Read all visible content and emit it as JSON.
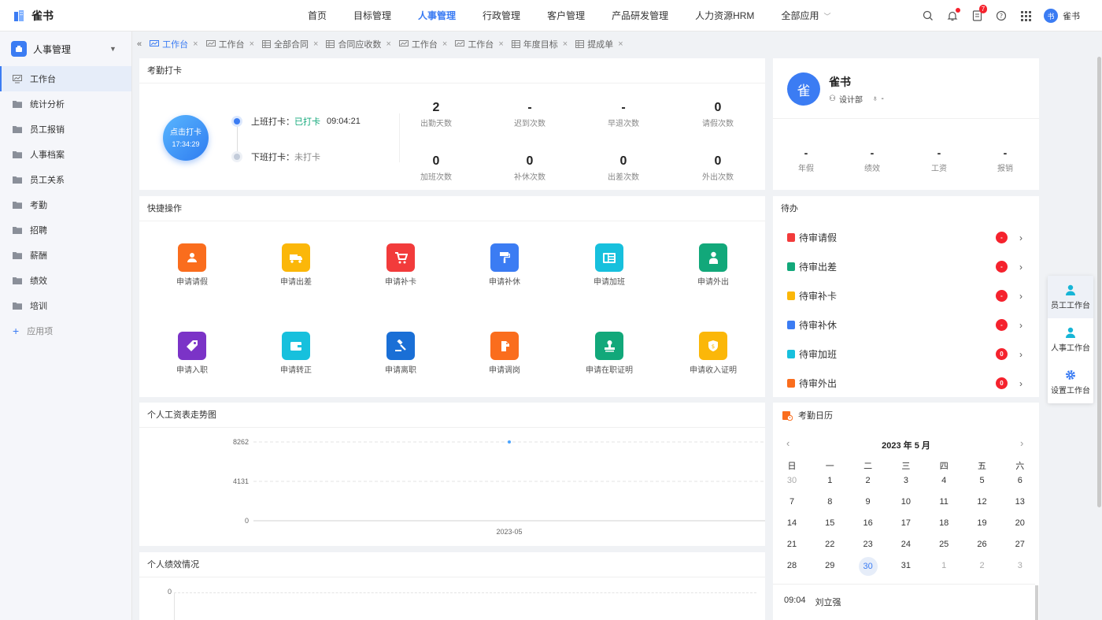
{
  "app": {
    "name": "雀书"
  },
  "topnav": [
    {
      "label": "首页",
      "active": false
    },
    {
      "label": "目标管理",
      "active": false
    },
    {
      "label": "人事管理",
      "active": true
    },
    {
      "label": "行政管理",
      "active": false
    },
    {
      "label": "客户管理",
      "active": false
    },
    {
      "label": "产品研发管理",
      "active": false
    },
    {
      "label": "人力资源HRM",
      "active": false
    },
    {
      "label": "全部应用",
      "active": false
    }
  ],
  "header": {
    "notification_count": "7",
    "user_avatar": "书",
    "user_name": "雀书"
  },
  "sidebar": {
    "module": "人事管理",
    "items": [
      {
        "label": "工作台",
        "icon": "monitor-icon",
        "active": true
      },
      {
        "label": "统计分析",
        "icon": "folder-icon"
      },
      {
        "label": "员工报销",
        "icon": "folder-icon"
      },
      {
        "label": "人事档案",
        "icon": "folder-icon"
      },
      {
        "label": "员工关系",
        "icon": "folder-icon"
      },
      {
        "label": "考勤",
        "icon": "folder-icon"
      },
      {
        "label": "招聘",
        "icon": "folder-icon"
      },
      {
        "label": "薪酬",
        "icon": "folder-icon"
      },
      {
        "label": "绩效",
        "icon": "folder-icon"
      },
      {
        "label": "培训",
        "icon": "folder-icon"
      }
    ],
    "add_label": "应用项"
  },
  "tabs": [
    {
      "label": "工作台",
      "icon": "chart-icon",
      "active": true
    },
    {
      "label": "工作台",
      "icon": "chart-icon"
    },
    {
      "label": "全部合同",
      "icon": "table-icon"
    },
    {
      "label": "合同应收数",
      "icon": "table-icon"
    },
    {
      "label": "工作台",
      "icon": "chart-icon"
    },
    {
      "label": "工作台",
      "icon": "chart-icon"
    },
    {
      "label": "年度目标",
      "icon": "table-icon"
    },
    {
      "label": "提成单",
      "icon": "table-icon"
    }
  ],
  "attendance": {
    "title": "考勤打卡",
    "punch_button": "点击打卡",
    "punch_time": "17:34:29",
    "clock_in_label": "上班打卡：",
    "clock_in_status": "已打卡",
    "clock_in_time": "09:04:21",
    "clock_out_label": "下班打卡：",
    "clock_out_status": "未打卡",
    "stats": [
      {
        "value": "2",
        "label": "出勤天数"
      },
      {
        "value": "-",
        "label": "迟到次数"
      },
      {
        "value": "-",
        "label": "早退次数"
      },
      {
        "value": "0",
        "label": "请假次数"
      },
      {
        "value": "0",
        "label": "加班次数"
      },
      {
        "value": "0",
        "label": "补休次数"
      },
      {
        "value": "0",
        "label": "出差次数"
      },
      {
        "value": "0",
        "label": "外出次数"
      }
    ]
  },
  "profile": {
    "avatar": "雀",
    "name": "雀书",
    "dept": "设计部",
    "extra": "-",
    "stats": [
      {
        "value": "-",
        "label": "年假"
      },
      {
        "value": "-",
        "label": "绩效"
      },
      {
        "value": "-",
        "label": "工资"
      },
      {
        "value": "-",
        "label": "报销"
      }
    ]
  },
  "quick": {
    "title": "快捷操作",
    "items": [
      {
        "label": "申请请假",
        "color": "#fa6d1d",
        "icon": "people-icon"
      },
      {
        "label": "申请出差",
        "color": "#fbb709",
        "icon": "truck-icon"
      },
      {
        "label": "申请补卡",
        "color": "#f23b3b",
        "icon": "cart-icon"
      },
      {
        "label": "申请补休",
        "color": "#3b7cf3",
        "icon": "paint-roller-icon"
      },
      {
        "label": "申请加班",
        "color": "#17c0dd",
        "icon": "list-icon"
      },
      {
        "label": "申请外出",
        "color": "#12a87a",
        "icon": "person-icon"
      },
      {
        "label": "申请入职",
        "color": "#7b33c7",
        "icon": "tag-icon"
      },
      {
        "label": "申请转正",
        "color": "#17c0dd",
        "icon": "wallet-icon"
      },
      {
        "label": "申请离职",
        "color": "#1a6fd6",
        "icon": "gavel-icon"
      },
      {
        "label": "申请调岗",
        "color": "#fa6d1d",
        "icon": "dog-icon"
      },
      {
        "label": "申请在职证明",
        "color": "#12a87a",
        "icon": "stamp-icon"
      },
      {
        "label": "申请收入证明",
        "color": "#fbb709",
        "icon": "money-shield-icon"
      }
    ]
  },
  "todo": {
    "title": "待办",
    "items": [
      {
        "label": "待审请假",
        "badge": "-",
        "color": "#f23b3b"
      },
      {
        "label": "待审出差",
        "badge": "-",
        "color": "#12a87a"
      },
      {
        "label": "待审补卡",
        "badge": "-",
        "color": "#fbb709"
      },
      {
        "label": "待审补休",
        "badge": "-",
        "color": "#3b7cf3"
      },
      {
        "label": "待审加班",
        "badge": "0",
        "color": "#17c0dd"
      },
      {
        "label": "待审外出",
        "badge": "0",
        "color": "#fa6d1d"
      }
    ]
  },
  "salary_chart": {
    "title": "个人工资表走势图"
  },
  "chart_data": {
    "type": "scatter",
    "x": [
      "2023-05"
    ],
    "series": [
      {
        "values": [
          8262
        ]
      }
    ],
    "yticks": [
      0,
      4131,
      8262
    ],
    "ylim": [
      0,
      8262
    ],
    "grid": true
  },
  "perf_chart": {
    "title": "个人绩效情况",
    "ytick": "0"
  },
  "calendar": {
    "title": "考勤日历",
    "month": "2023 年 5 月",
    "weekdays": [
      "日",
      "一",
      "二",
      "三",
      "四",
      "五",
      "六"
    ],
    "weeks": [
      [
        "30",
        "1",
        "2",
        "3",
        "4",
        "5",
        "6"
      ],
      [
        "7",
        "8",
        "9",
        "10",
        "11",
        "12",
        "13"
      ],
      [
        "14",
        "15",
        "16",
        "17",
        "18",
        "19",
        "20"
      ],
      [
        "21",
        "22",
        "23",
        "24",
        "25",
        "26",
        "27"
      ],
      [
        "28",
        "29",
        "30",
        "31",
        "1",
        "2",
        "3"
      ]
    ],
    "log_time": "09:04",
    "log_name": "刘立强"
  },
  "floating": [
    {
      "label": "员工工作台",
      "icon": "user-icon",
      "active": true
    },
    {
      "label": "人事工作台",
      "icon": "user-icon"
    },
    {
      "label": "设置工作台",
      "icon": "gear-icon"
    }
  ]
}
